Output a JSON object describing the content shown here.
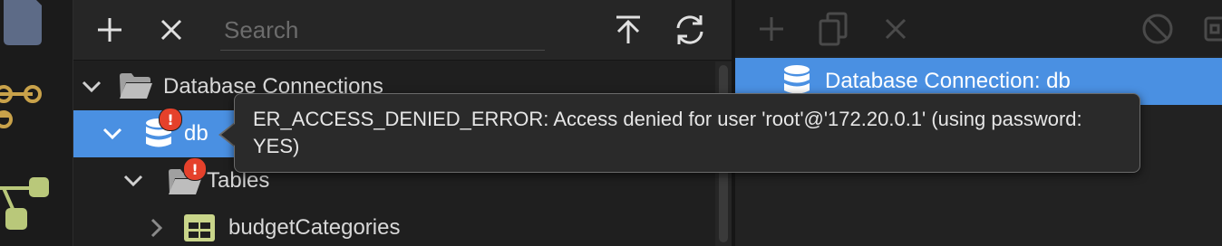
{
  "left_toolbar": {
    "add_tooltip": "+",
    "search_placeholder": "Search"
  },
  "tree": {
    "root_label": "Database Connections",
    "connection_label": "db",
    "connection_badge": "!",
    "tables_label": "Tables",
    "tables_badge": "!",
    "table_item_label": "budgetCategories"
  },
  "tooltip": {
    "text": "ER_ACCESS_DENIED_ERROR: Access denied for user 'root'@'172.20.0.1' (using password: YES)"
  },
  "right_panel": {
    "selected_label": "Database Connection: db"
  },
  "colors": {
    "selection": "#4a90e2",
    "error_badge": "#e5412b",
    "table_icon": "#c9d58a",
    "rail_node": "#c9a24a",
    "rail_node_green": "#b9c87a"
  }
}
